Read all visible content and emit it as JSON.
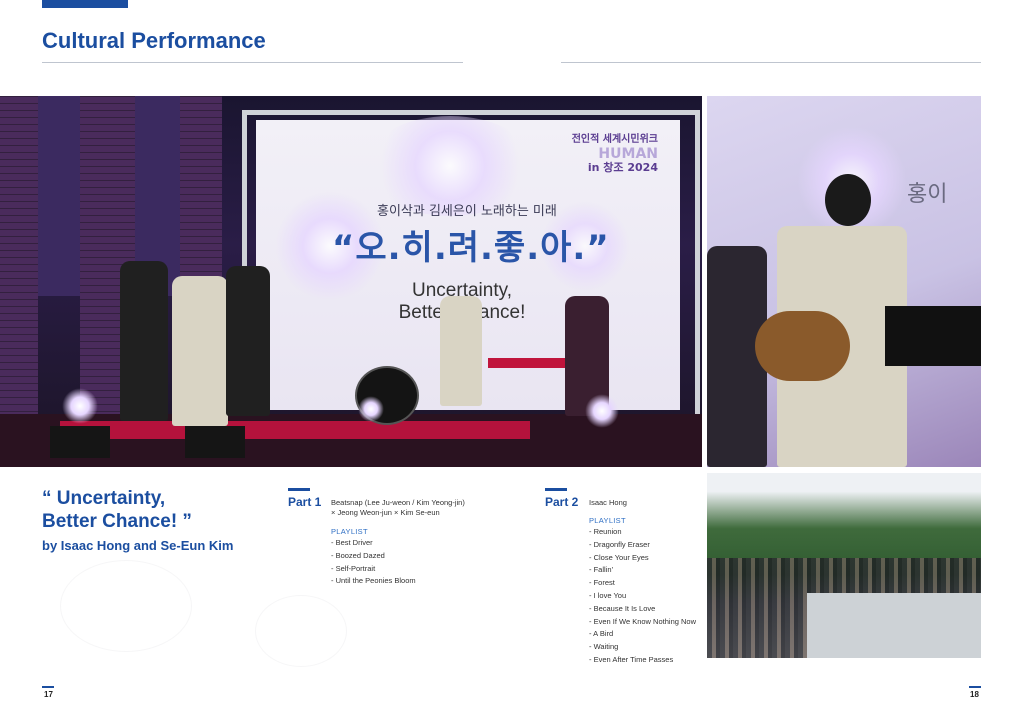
{
  "header": {
    "title": "Cultural Performance"
  },
  "photos": {
    "main": {
      "screen_korean_subtitle": "홍이삭과 김세은이 노래하는 미래",
      "screen_korean_title": "“오.히.려.좋.아.”",
      "screen_english_line1": "Uncertainty,",
      "screen_english_line2": "Better Chance!",
      "screen_logo_line1": "전인적 세계시민위크",
      "screen_logo_line2": "HUMAN",
      "screen_logo_line3": "in 창조 2024"
    }
  },
  "performance": {
    "quote_line1": "“ Uncertainty,",
    "quote_line2": "Better Chance! ”",
    "byline": "by Isaac Hong and Se-Eun Kim"
  },
  "part1": {
    "label": "Part 1",
    "artist_line1": "Beatsnap (Lee Ju-weon / Kim Yeong-jin)",
    "artist_line2": "× Jeong Weon-jun × Kim Se-eun",
    "playlist_heading": "PLAYLIST",
    "playlist": [
      "- Best Driver",
      "- Boozed Dazed",
      "- Self-Portrait",
      "- Until the Peonies Bloom"
    ]
  },
  "part2": {
    "label": "Part 2",
    "artist": "Isaac Hong",
    "playlist_heading": "PLAYLIST",
    "playlist": [
      "- Reunion",
      "- Dragonfly Eraser",
      "- Close Your Eyes",
      "- Fallin’",
      "- Forest",
      "- I love You",
      "- Because It Is Love",
      "- Even If We Know Nothing Now",
      "- A Bird",
      "- Waiting",
      "- Even After Time Passes"
    ]
  },
  "footer": {
    "page_left": "17",
    "page_right": "18"
  },
  "colors": {
    "accent": "#1b4ea0",
    "playlist_heading": "#2f6fc4",
    "rule": "#bfc5cf"
  }
}
